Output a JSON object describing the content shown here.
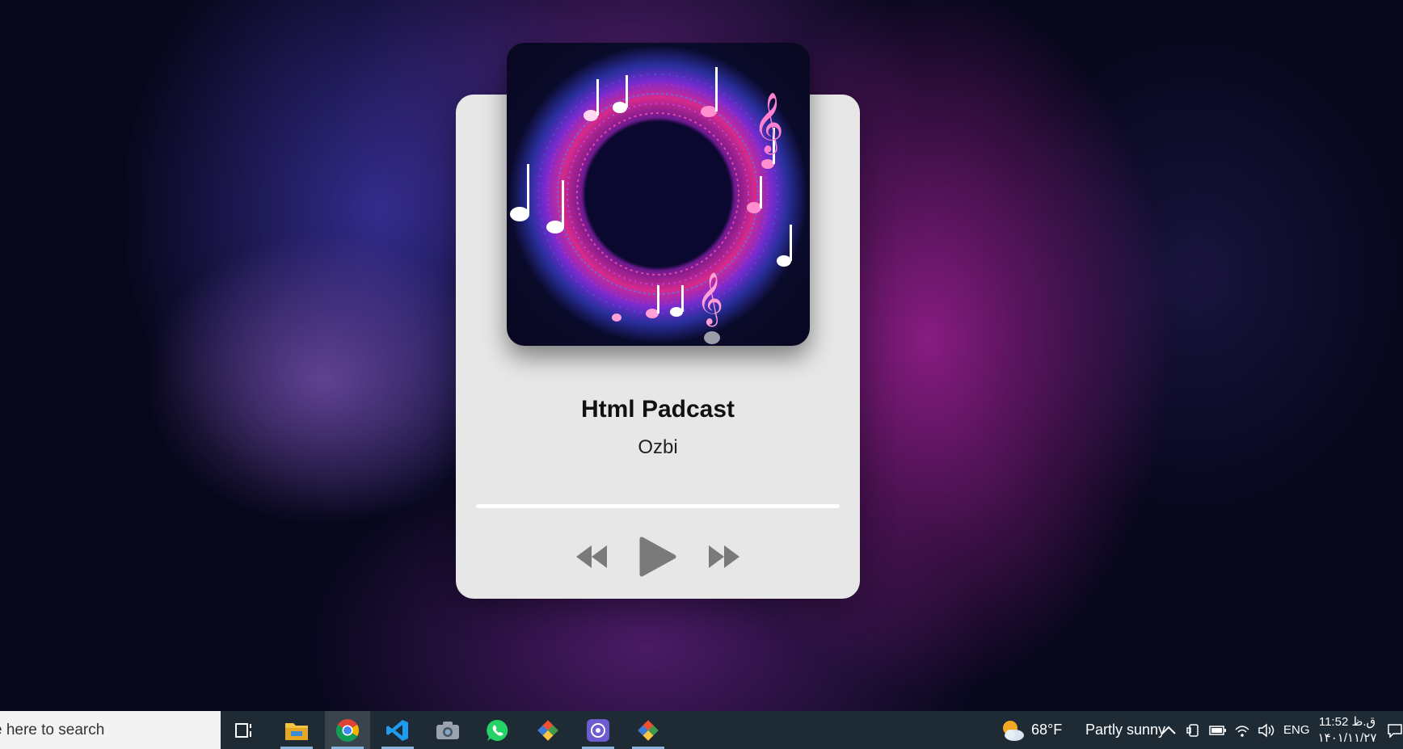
{
  "player": {
    "title": "Html Padcast",
    "artist": "Ozbi",
    "progress": 0,
    "cover_icon": "music-notes-circle-artwork"
  },
  "controls": {
    "prev_icon": "rewind-icon",
    "play_icon": "play-icon",
    "next_icon": "fast-forward-icon",
    "color": "#7a7a7a"
  },
  "taskbar": {
    "search_placeholder": "e here to search",
    "apps": [
      "task-view-icon",
      "file-explorer-icon",
      "chrome-icon",
      "vscode-icon",
      "camera-icon",
      "whatsapp-icon",
      "git-icon",
      "app-icon",
      "git-icon"
    ],
    "weather_temp": "68°F",
    "weather_desc": "Partly sunny",
    "language": "ENG",
    "time": "11:52 ق.ظ",
    "date": "۱۴۰۱/۱۱/۲۷"
  }
}
